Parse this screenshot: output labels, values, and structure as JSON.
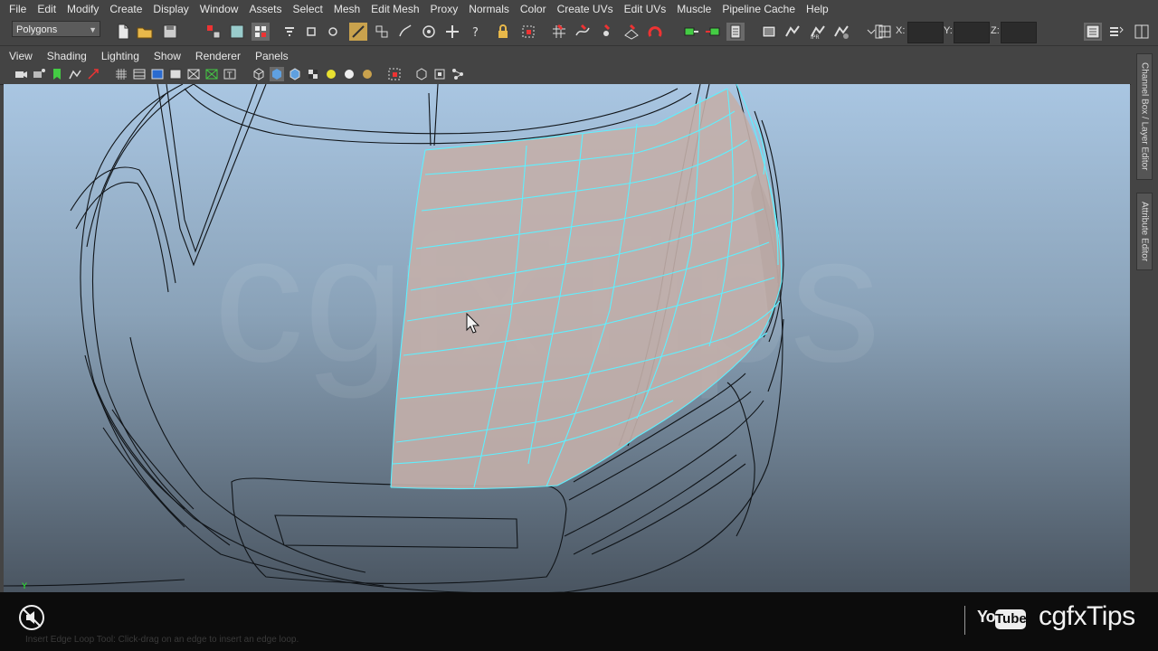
{
  "menubar": {
    "items": [
      "File",
      "Edit",
      "Modify",
      "Create",
      "Display",
      "Window",
      "Assets",
      "Select",
      "Mesh",
      "Edit Mesh",
      "Proxy",
      "Normals",
      "Color",
      "Create UVs",
      "Edit UVs",
      "Muscle",
      "Pipeline Cache",
      "Help"
    ]
  },
  "shelf": {
    "mode_value": "Polygons",
    "x_label": "X:",
    "y_label": "Y:",
    "z_label": "Z:",
    "x_value": "",
    "y_value": "",
    "z_value": ""
  },
  "panel": {
    "menus": [
      "View",
      "Shading",
      "Lighting",
      "Show",
      "Renderer",
      "Panels"
    ]
  },
  "right_tabs": {
    "channel_box": "Channel Box / Layer Editor",
    "attribute_editor": "Attribute Editor"
  },
  "viewport": {
    "watermark": "cgfxTips",
    "axis_label": "Y"
  },
  "status": {
    "help_line": "Insert Edge Loop Tool: Click-drag on an edge to insert an edge loop."
  },
  "branding": {
    "youtube_you": "You",
    "youtube_tube": "Tube",
    "channel": "cgfxTips"
  },
  "colors": {
    "ui_bg": "#444444",
    "viewport_top": "#a9c6e2",
    "viewport_bottom": "#4a5561",
    "mesh_fill": "#c3afaa",
    "wire_highlight": "#5ef0ff",
    "bottom_bar": "#0c0c0c"
  }
}
